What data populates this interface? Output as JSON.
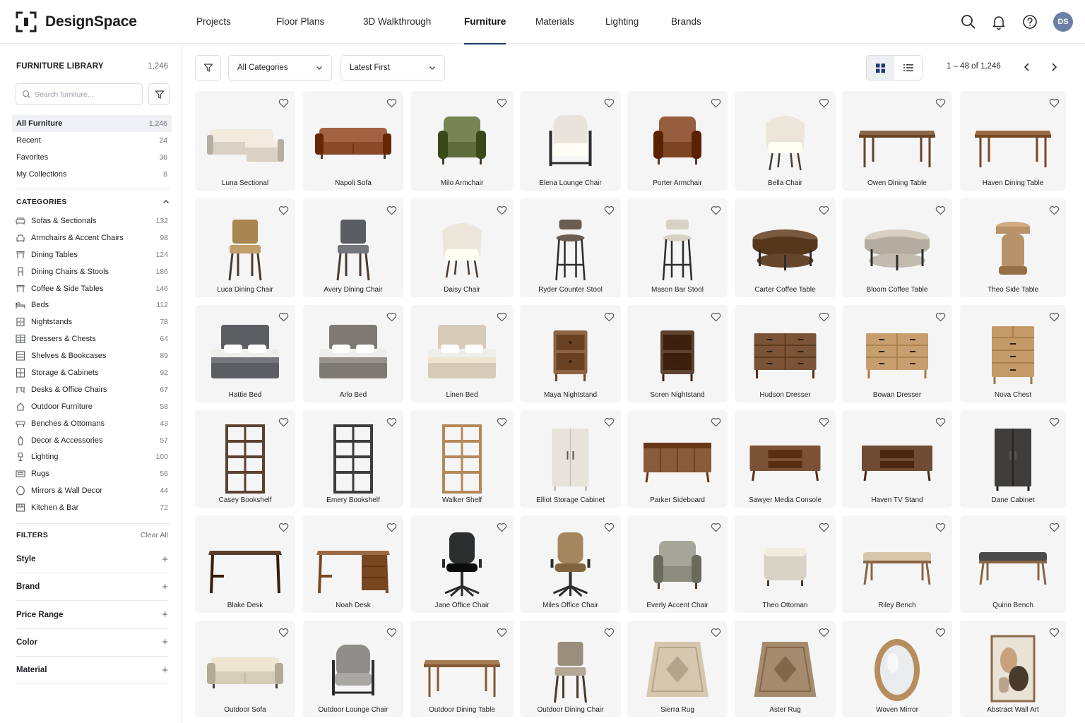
{
  "app": {
    "name": "DesignSpace"
  },
  "nav": {
    "items": [
      "Projects",
      "Floor Plans",
      "3D Walkthrough",
      "Furniture",
      "Materials",
      "Lighting",
      "Brands"
    ],
    "active": "Furniture"
  },
  "user": {
    "initials": "DS"
  },
  "sidebar": {
    "title": "FURNITURE LIBRARY",
    "total": "1,246",
    "search_placeholder": "Search furniture...",
    "quick": [
      {
        "label": "All Furniture",
        "count": "1,246",
        "active": true
      },
      {
        "label": "Recent",
        "count": "24"
      },
      {
        "label": "Favorites",
        "count": "36"
      },
      {
        "label": "My Collections",
        "count": "8"
      }
    ],
    "categories_title": "CATEGORIES",
    "categories": [
      {
        "label": "Sofas & Sectionals",
        "count": "132",
        "icon": "sofa-icon"
      },
      {
        "label": "Armchairs & Accent Chairs",
        "count": "98",
        "icon": "armchair-icon"
      },
      {
        "label": "Dining Tables",
        "count": "124",
        "icon": "table-icon"
      },
      {
        "label": "Dining Chairs & Stools",
        "count": "186",
        "icon": "chair-icon"
      },
      {
        "label": "Coffee & Side Tables",
        "count": "146",
        "icon": "table-icon"
      },
      {
        "label": "Beds",
        "count": "112",
        "icon": "bed-icon"
      },
      {
        "label": "Nightstands",
        "count": "78",
        "icon": "nightstand-icon"
      },
      {
        "label": "Dressers & Chests",
        "count": "64",
        "icon": "dresser-icon"
      },
      {
        "label": "Shelves & Bookcases",
        "count": "89",
        "icon": "shelf-icon"
      },
      {
        "label": "Storage & Cabinets",
        "count": "92",
        "icon": "cabinet-icon"
      },
      {
        "label": "Desks & Office Chairs",
        "count": "67",
        "icon": "desk-icon"
      },
      {
        "label": "Outdoor Furniture",
        "count": "58",
        "icon": "outdoor-icon"
      },
      {
        "label": "Benches & Ottomans",
        "count": "43",
        "icon": "bench-icon"
      },
      {
        "label": "Decor & Accessories",
        "count": "57",
        "icon": "decor-icon"
      },
      {
        "label": "Lighting",
        "count": "100",
        "icon": "lamp-icon"
      },
      {
        "label": "Rugs",
        "count": "56",
        "icon": "rug-icon"
      },
      {
        "label": "Mirrors & Wall Decor",
        "count": "44",
        "icon": "mirror-icon"
      },
      {
        "label": "Kitchen & Bar",
        "count": "72",
        "icon": "kitchen-icon"
      }
    ],
    "filters_title": "FILTERS",
    "clear_all": "Clear All",
    "facets": [
      "Style",
      "Brand",
      "Price Range",
      "Color",
      "Material"
    ]
  },
  "toolbar": {
    "category_select": "All Categories",
    "sort_select": "Latest First",
    "pagination": "1 – 48 of 1,246"
  },
  "products": [
    {
      "name": "Luna Sectional",
      "kind": "sectional",
      "color": "#d9d1c3"
    },
    {
      "name": "Napoli Sofa",
      "kind": "sofa",
      "color": "#8a4a2a"
    },
    {
      "name": "Milo Armchair",
      "kind": "armchair",
      "color": "#5e6b3a"
    },
    {
      "name": "Elena Lounge Chair",
      "kind": "lounge",
      "color": "#e8e4dc"
    },
    {
      "name": "Porter Armchair",
      "kind": "armchair",
      "color": "#7e4426"
    },
    {
      "name": "Bella Chair",
      "kind": "tubchair",
      "color": "#ece6da"
    },
    {
      "name": "Owen Dining Table",
      "kind": "table",
      "color": "#8a6647"
    },
    {
      "name": "Haven Dining Table",
      "kind": "table",
      "color": "#9a6a44"
    },
    {
      "name": "Luca Dining Chair",
      "kind": "dchair",
      "color": "#a8864f"
    },
    {
      "name": "Avery Dining Chair",
      "kind": "dchair",
      "color": "#5a5e63"
    },
    {
      "name": "Daisy Chair",
      "kind": "tubchair",
      "color": "#ece6da"
    },
    {
      "name": "Ryder Counter Stool",
      "kind": "stool",
      "color": "#6a5e52"
    },
    {
      "name": "Mason Bar Stool",
      "kind": "stool",
      "color": "#d8d2c6"
    },
    {
      "name": "Carter Coffee Table",
      "kind": "roundtable",
      "color": "#7a5a3e"
    },
    {
      "name": "Bloom Coffee Table",
      "kind": "roundtable",
      "color": "#d6cfc2"
    },
    {
      "name": "Theo Side Table",
      "kind": "sidetable",
      "color": "#b89268"
    },
    {
      "name": "Hattie Bed",
      "kind": "bed",
      "color": "#5c5e61"
    },
    {
      "name": "Arlo Bed",
      "kind": "bed",
      "color": "#7d7a74"
    },
    {
      "name": "Linen Bed",
      "kind": "bed",
      "color": "#d6cbb8"
    },
    {
      "name": "Maya Nightstand",
      "kind": "nightstand",
      "color": "#8e6544"
    },
    {
      "name": "Soren Nightstand",
      "kind": "nightstand",
      "color": "#5e4331"
    },
    {
      "name": "Hudson Dresser",
      "kind": "dresser",
      "color": "#7b5437"
    },
    {
      "name": "Bowan Dresser",
      "kind": "dresser",
      "color": "#c79e6d"
    },
    {
      "name": "Nova Chest",
      "kind": "chest",
      "color": "#c49a68"
    },
    {
      "name": "Casey Bookshelf",
      "kind": "bookshelf",
      "color": "#5d4231"
    },
    {
      "name": "Emery Bookshelf",
      "kind": "bookshelf",
      "color": "#3d3d3f"
    },
    {
      "name": "Walker Shelf",
      "kind": "bookshelf",
      "color": "#b5885a"
    },
    {
      "name": "Elliot Storage Cabinet",
      "kind": "cabinet",
      "color": "#e7e3da"
    },
    {
      "name": "Parker Sideboard",
      "kind": "sideboard",
      "color": "#8a5b3a"
    },
    {
      "name": "Sawyer Media Console",
      "kind": "console",
      "color": "#7b5236"
    },
    {
      "name": "Haven TV Stand",
      "kind": "console",
      "color": "#6e4b33"
    },
    {
      "name": "Dane Cabinet",
      "kind": "cabinet",
      "color": "#3f3e3c"
    },
    {
      "name": "Blake Desk",
      "kind": "desk",
      "color": "#5b3e2c"
    },
    {
      "name": "Noah Desk",
      "kind": "desk",
      "color": "#9a6a44"
    },
    {
      "name": "Jane Office Chair",
      "kind": "office",
      "color": "#2d2e30"
    },
    {
      "name": "Miles Office Chair",
      "kind": "office",
      "color": "#a5875f"
    },
    {
      "name": "Everly Accent Chair",
      "kind": "armchair",
      "color": "#8d8c80"
    },
    {
      "name": "Theo Ottoman",
      "kind": "ottoman",
      "color": "#d9d3c6"
    },
    {
      "name": "Riley Bench",
      "kind": "bench",
      "color": "#d7c6a8"
    },
    {
      "name": "Quinn Bench",
      "kind": "bench",
      "color": "#4a4a4a"
    },
    {
      "name": "Outdoor Sofa",
      "kind": "sofa",
      "color": "#d6cdb8"
    },
    {
      "name": "Outdoor Lounge Chair",
      "kind": "lounge",
      "color": "#8f8e89"
    },
    {
      "name": "Outdoor Dining Table",
      "kind": "table",
      "color": "#a77c54"
    },
    {
      "name": "Outdoor Dining Chair",
      "kind": "dchair",
      "color": "#9a8e7c"
    },
    {
      "name": "Sierra Rug",
      "kind": "rug",
      "color": "#d6c7ae"
    },
    {
      "name": "Aster Rug",
      "kind": "rug",
      "color": "#a58a6e"
    },
    {
      "name": "Woven Mirror",
      "kind": "mirror",
      "color": "#b88d5d"
    },
    {
      "name": "Abstract Wall Art",
      "kind": "art",
      "color": "#c7a27c"
    }
  ]
}
